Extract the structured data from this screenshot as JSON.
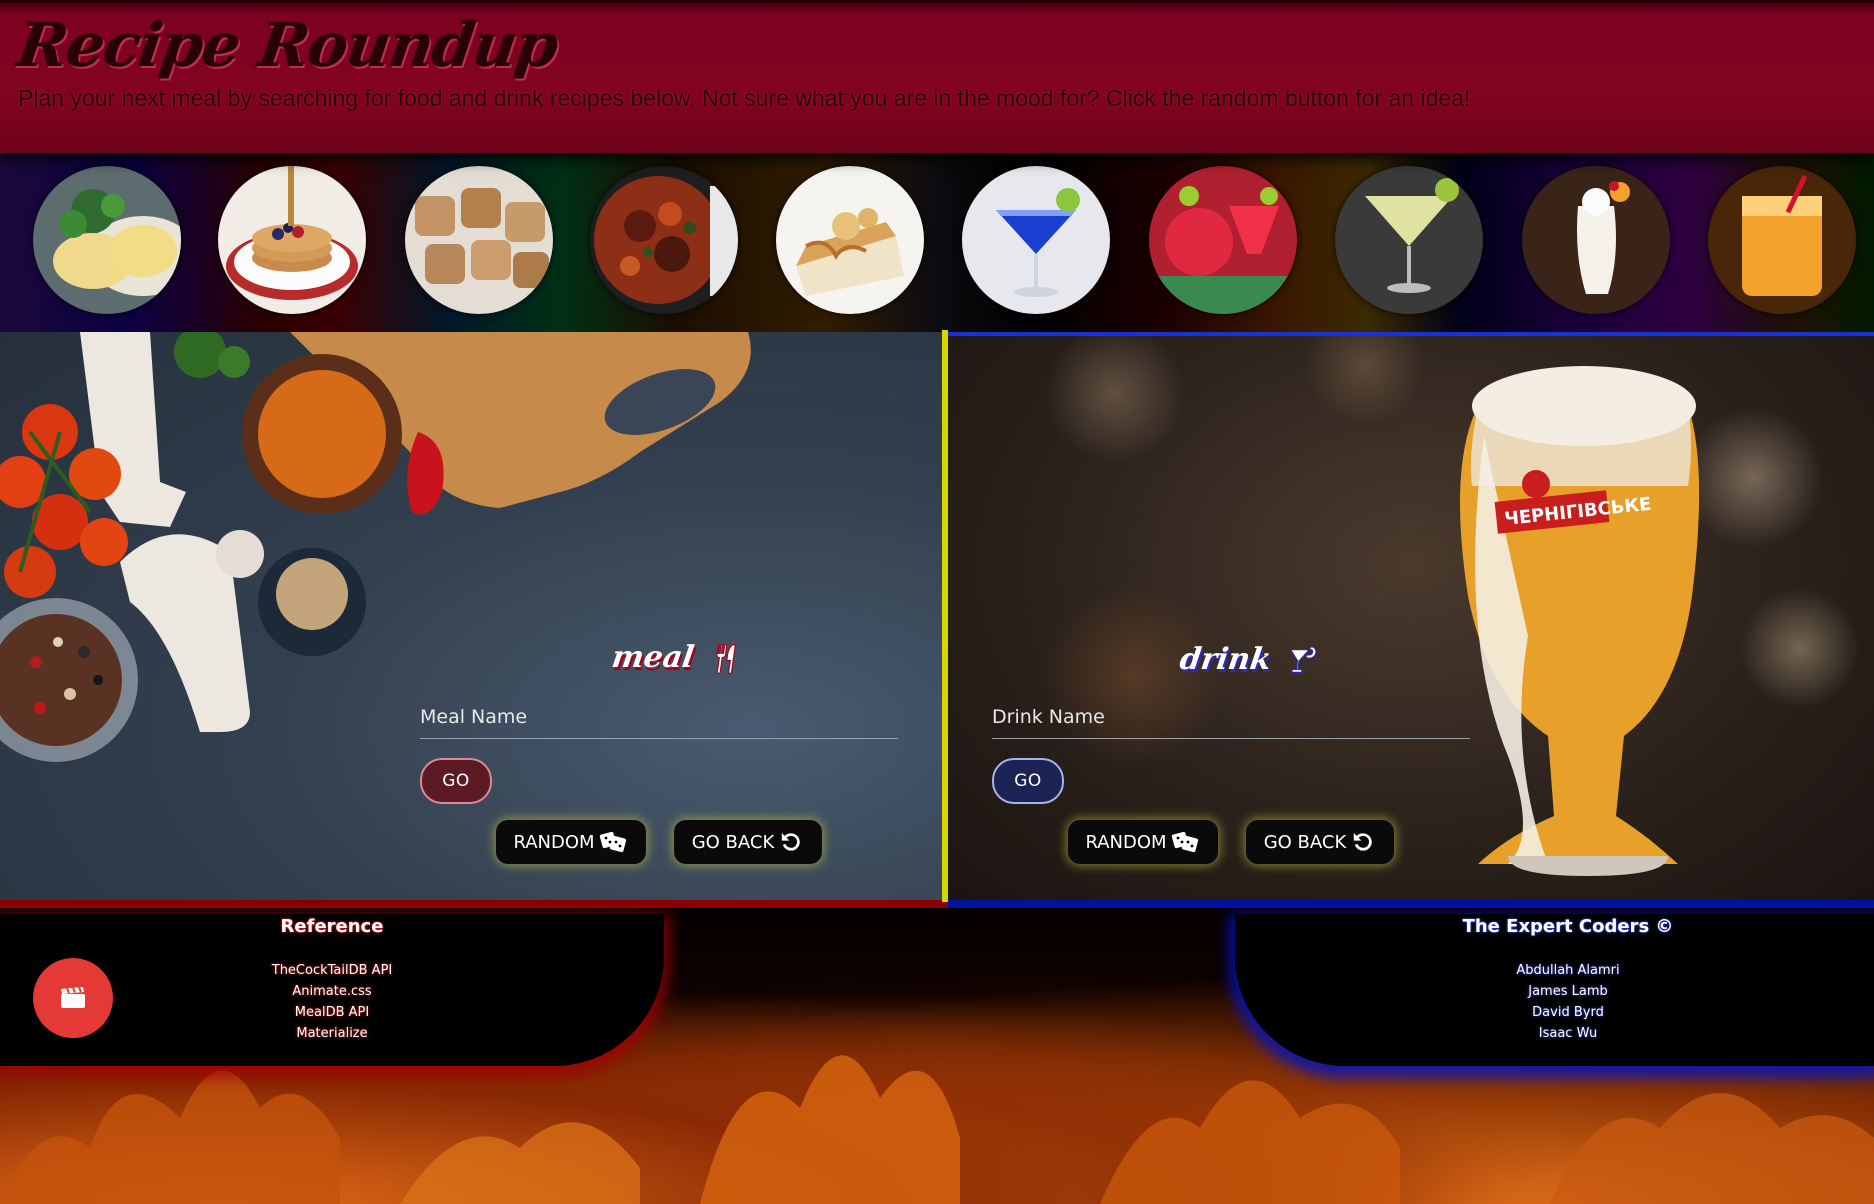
{
  "header": {
    "title": "Recipe Roundup",
    "subtitle": "Plan your next meal by searching for food and drink recipes below. Not sure what you are in the mood for? Click the random button for an idea!"
  },
  "carousel": {
    "items": [
      "omelette-photo",
      "pancakes-photo",
      "cookies-photo",
      "stew-photo",
      "cheesecake-photo",
      "blue-martini-photo",
      "red-cocktail-photo",
      "margarita-photo",
      "pina-colada-photo",
      "orange-cocktail-photo"
    ]
  },
  "meal": {
    "title": "meal",
    "placeholder": "Meal Name",
    "go_label": "GO",
    "random_label": "RANDOM",
    "back_label": "GO BACK"
  },
  "drink": {
    "title": "drink",
    "placeholder": "Drink Name",
    "go_label": "GO",
    "random_label": "RANDOM",
    "back_label": "GO BACK"
  },
  "footer": {
    "reference": {
      "heading": "Reference",
      "items": [
        "TheCockTailDB API",
        "Animate.css",
        "MealDB API",
        "Materialize"
      ]
    },
    "credits": {
      "heading": "The Expert Coders ©",
      "items": [
        "Abdullah Alamri",
        "James Lamb",
        "David Byrd",
        "Isaac Wu"
      ]
    }
  },
  "colors": {
    "header_bg": "#83031f",
    "meal_accent": "#a4001a",
    "drink_accent": "#1733d8",
    "divider": "#d6d600",
    "fab": "#e53935"
  }
}
